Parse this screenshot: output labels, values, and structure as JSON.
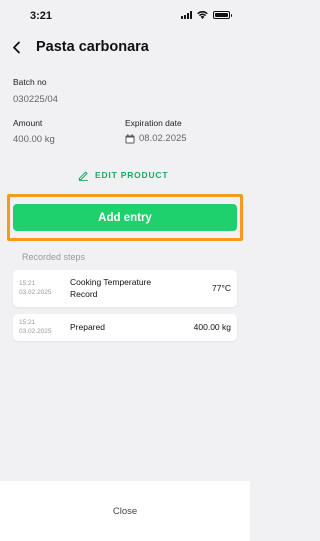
{
  "status_bar": {
    "time": "3:21"
  },
  "header": {
    "title": "Pasta carbonara",
    "back_icon": "chevron-left-icon"
  },
  "batch": {
    "label": "Batch no",
    "value": "030225/04"
  },
  "amount": {
    "label": "Amount",
    "value": "400.00 kg"
  },
  "expiration": {
    "label": "Expiration date",
    "value": "08.02.2025",
    "icon": "calendar-icon"
  },
  "edit_product": {
    "label": "EDIT PRODUCT",
    "icon": "pencil-icon"
  },
  "add_entry": {
    "label": "Add entry"
  },
  "recorded_steps": {
    "title": "Recorded steps",
    "items": [
      {
        "time": "15:21",
        "date": "03.02.2025",
        "name_line1": "Cooking Temperature",
        "name_line2": "Record",
        "value": "77°C"
      },
      {
        "time": "15:21",
        "date": "03.02.2025",
        "name_line1": "Prepared",
        "name_line2": "",
        "value": "400.00 kg"
      }
    ]
  },
  "footer": {
    "close_label": "Close"
  },
  "colors": {
    "accent_green": "#1ed16d",
    "edit_green": "#1fa862",
    "highlight_orange": "#f39b1d"
  }
}
